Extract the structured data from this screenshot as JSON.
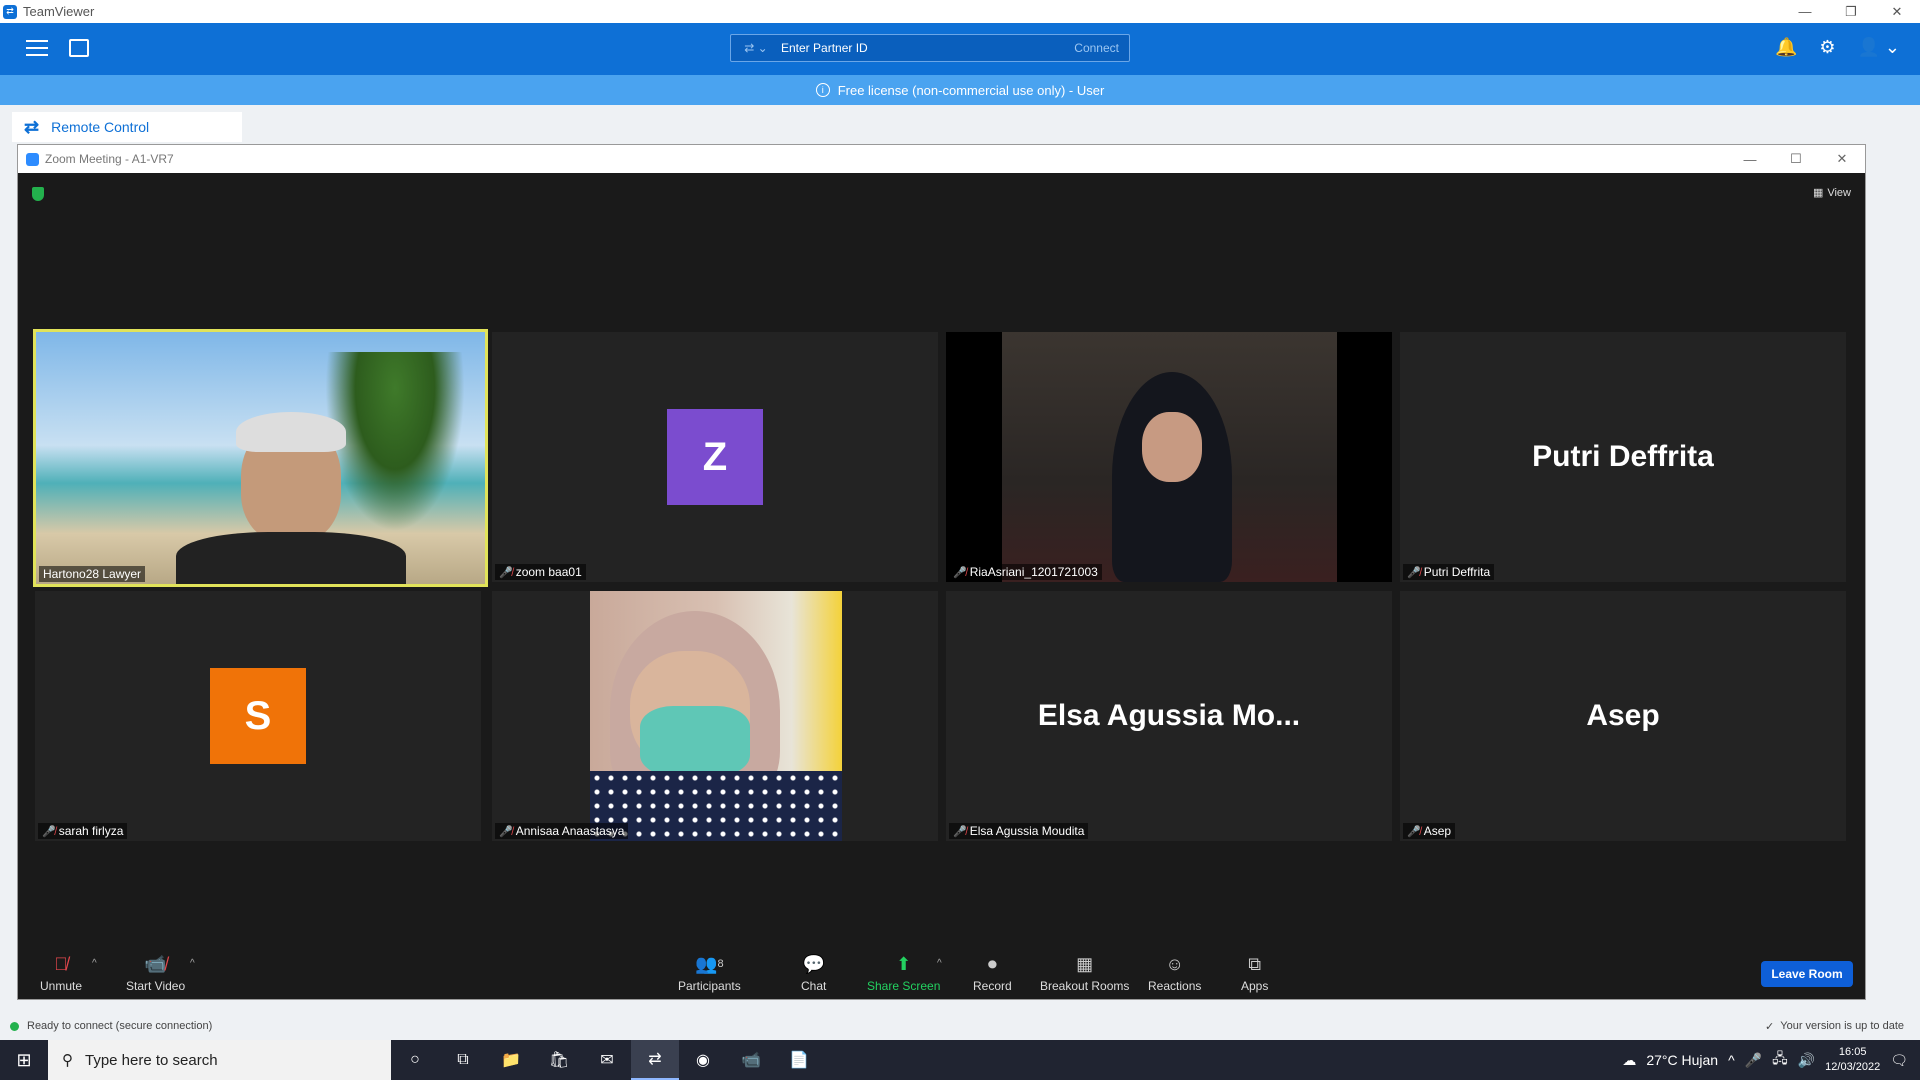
{
  "teamviewer": {
    "title": "TeamViewer",
    "partner_placeholder": "Enter Partner ID",
    "connect_label": "Connect",
    "banner": "Free license (non-commercial use only) - User",
    "remote_control_label": "Remote Control",
    "status_text": "Ready to connect (secure connection)",
    "update_text": "Your version is up to date"
  },
  "zoom": {
    "window_title": "Zoom Meeting - A1-VR7",
    "view_label": "View",
    "participants": [
      {
        "name": "Hartono28 Lawyer",
        "muted": false,
        "type": "video"
      },
      {
        "name": "zoom baa01",
        "muted": true,
        "type": "avatar",
        "letter": "Z",
        "color": "#7b4ccf"
      },
      {
        "name": "RiaAsriani_1201721003",
        "muted": true,
        "type": "video"
      },
      {
        "name": "Putri Deffrita",
        "muted": true,
        "type": "name",
        "display": "Putri Deffrita"
      },
      {
        "name": "sarah firlyza",
        "muted": true,
        "type": "avatar",
        "letter": "S",
        "color": "#f07308"
      },
      {
        "name": "Annisaa Anaastasya",
        "muted": true,
        "type": "video"
      },
      {
        "name": "Elsa Agussia Moudita",
        "muted": true,
        "type": "name",
        "display": "Elsa Agussia Mo..."
      },
      {
        "name": "Asep",
        "muted": true,
        "type": "name",
        "display": "Asep"
      }
    ],
    "controls": {
      "unmute": "Unmute",
      "start_video": "Start Video",
      "participants": "Participants",
      "participants_count": "8",
      "chat": "Chat",
      "share_screen": "Share Screen",
      "record": "Record",
      "breakout_rooms": "Breakout Rooms",
      "reactions": "Reactions",
      "apps": "Apps",
      "leave_room": "Leave Room"
    }
  },
  "taskbar": {
    "search_placeholder": "Type here to search",
    "weather": "27°C  Hujan",
    "time": "16:05",
    "date": "12/03/2022"
  }
}
